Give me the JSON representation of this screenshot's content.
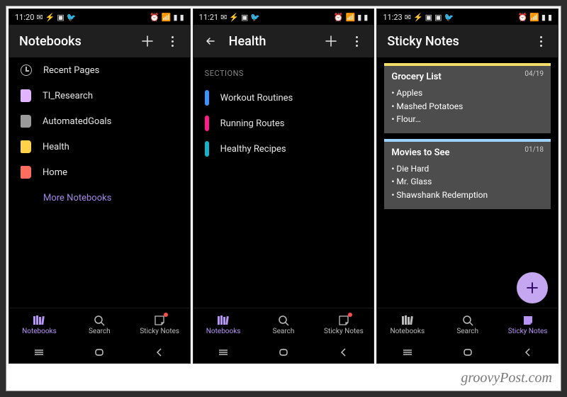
{
  "watermark": "groovyPost.com",
  "bottomTabs": {
    "notebooks": "Notebooks",
    "search": "Search",
    "sticky": "Sticky Notes"
  },
  "panel1": {
    "time": "11:20",
    "title": "Notebooks",
    "recent": "Recent Pages",
    "more": "More Notebooks",
    "nb": {
      "0": "TI_Research",
      "1": "AutomatedGoals",
      "2": "Health",
      "3": "Home"
    }
  },
  "panel2": {
    "time": "11:21",
    "title": "Health",
    "sections_label": "SECTIONS",
    "s": {
      "0": "Workout Routines",
      "1": "Running Routes",
      "2": "Healthy Recipes"
    }
  },
  "panel3": {
    "time": "11:23",
    "title": "Sticky Notes",
    "note1": {
      "title": "Grocery List",
      "date": "04/19",
      "i0": "Apples",
      "i1": "Mashed Potatoes",
      "i2": "Flour…"
    },
    "note2": {
      "title": "Movies to See",
      "date": "01/18",
      "i0": "Die Hard",
      "i1": "Mr. Glass",
      "i2": "Shawshank Redemption"
    }
  }
}
